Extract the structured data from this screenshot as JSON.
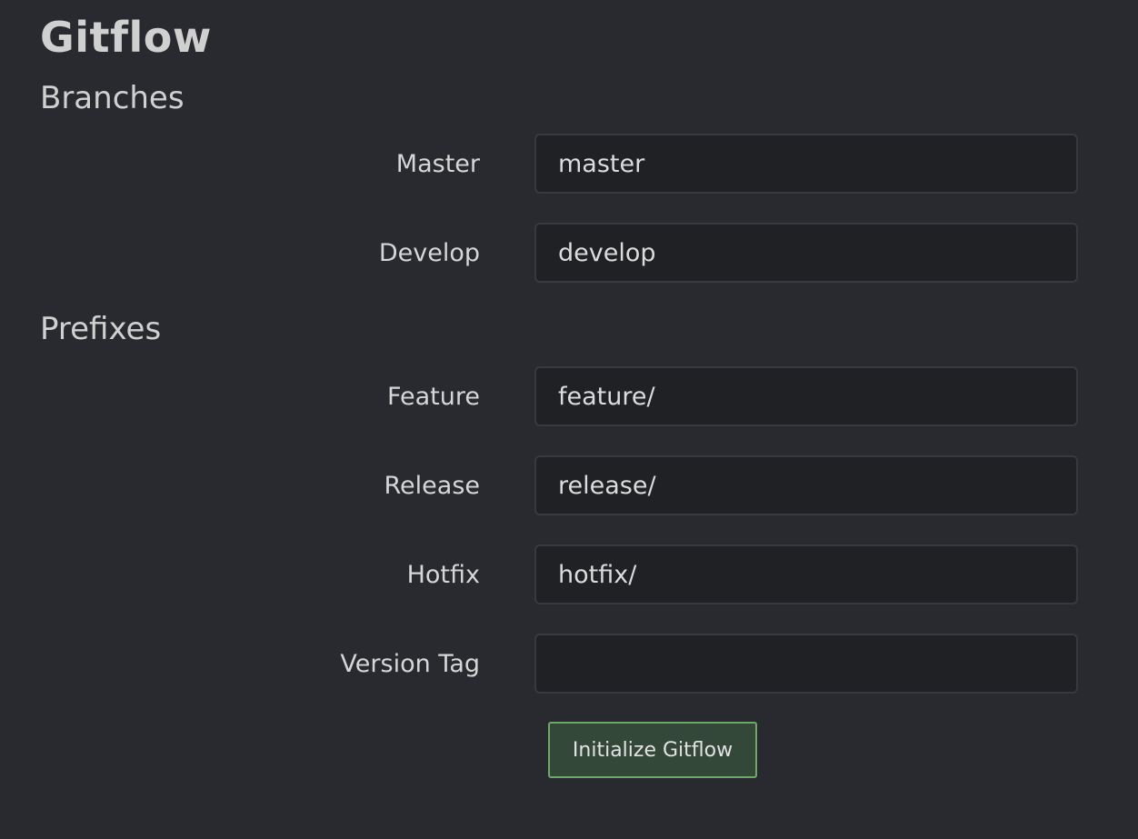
{
  "page": {
    "title": "Gitflow"
  },
  "sections": {
    "branches": {
      "heading": "Branches",
      "master": {
        "label": "Master",
        "value": "master"
      },
      "develop": {
        "label": "Develop",
        "value": "develop"
      }
    },
    "prefixes": {
      "heading": "Prefixes",
      "feature": {
        "label": "Feature",
        "value": "feature/"
      },
      "release": {
        "label": "Release",
        "value": "release/"
      },
      "hotfix": {
        "label": "Hotfix",
        "value": "hotfix/"
      },
      "version_tag": {
        "label": "Version Tag",
        "value": ""
      }
    }
  },
  "actions": {
    "initialize_label": "Initialize Gitflow"
  },
  "colors": {
    "background": "#292a2f",
    "input_background": "#202125",
    "button_background": "#34483a",
    "button_border": "#6ea866"
  }
}
